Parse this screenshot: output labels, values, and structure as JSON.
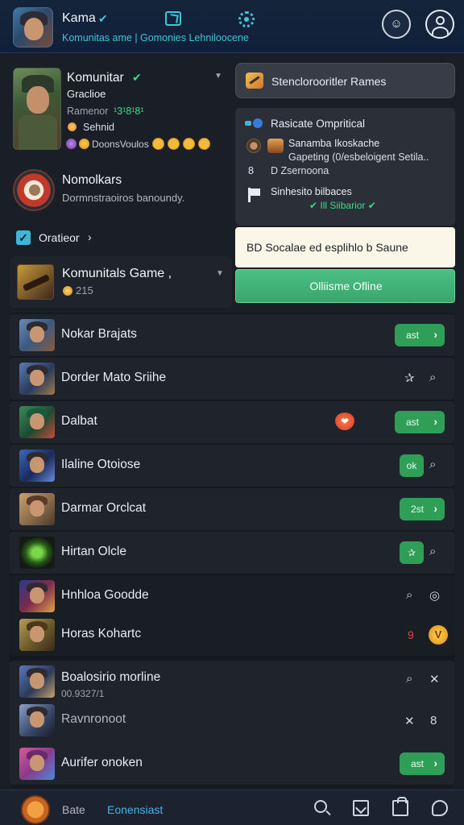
{
  "header": {
    "title": "Kama",
    "title_badge": "✔",
    "subtitle": "Komunitas ame | Gomonies Lehniloocene",
    "status_icon": "☺"
  },
  "profile": {
    "name": "Komunitar",
    "name_badge": "✔",
    "role": "Graclioe",
    "rank_label": "Ramenor",
    "rank_value": "¹3¹8¹8¹",
    "status": "Sehnid",
    "reactions": "DoonsVoulos"
  },
  "server": {
    "name": "Nomolkars",
    "description": "Dormnstraoiros banoundy."
  },
  "filter": {
    "label": "Oratieor",
    "chevron": "›",
    "check": "✓"
  },
  "group": {
    "title": "Komunitals Game ,",
    "count": "215"
  },
  "games_button": {
    "label": "Stenclorooritler Rames"
  },
  "activity": {
    "header": "Rasicate Ompritical",
    "line1": "Sanamba Ikoskache",
    "line2": "Gapeting (0/esbeloigent Setila..",
    "number": "8",
    "sub": "D  Zsernoona",
    "note": "Sinhesito bilbaces",
    "tag": "✔ Ill Siibarior ✔"
  },
  "suggestion": {
    "label": "BD  Socalae ed esplihlo b Saune"
  },
  "online_button": {
    "label": "Olliisme Ofline"
  },
  "games": [
    {
      "title": "Nokar Brajats",
      "action": "ast",
      "chevron": "›"
    },
    {
      "title": "Dorder Mato Sriihe",
      "icon1": "✰",
      "icon2": "⌕"
    },
    {
      "title": "Dalbat",
      "badge": "❤",
      "action": "ast",
      "chevron": "›"
    },
    {
      "title": "Ilaline Otoiose",
      "action": "ok",
      "icon2": "⌕"
    },
    {
      "title": "Darmar Orclcat",
      "action": "2st",
      "chevron": "›"
    },
    {
      "title": "Hirtan Olcle",
      "action": "✰",
      "icon2": "⌕"
    },
    {
      "title": "Hnhloa Goodde",
      "icon1": "⌕",
      "icon2": "◎"
    },
    {
      "title": "Horas Kohartc",
      "red": "9",
      "gold": "V"
    },
    {
      "title": "Boalosirio morline",
      "sub": "00.9327/1",
      "icon1": "⌕",
      "icon2": "✕"
    },
    {
      "title": "Ravnronoot",
      "icon1": "✕",
      "icon2": "8"
    },
    {
      "title": "Aurifer onoken",
      "action": "ast",
      "chevron": "›"
    }
  ],
  "bottom_nav": {
    "home": "Bate",
    "community": "Eonensiast"
  }
}
